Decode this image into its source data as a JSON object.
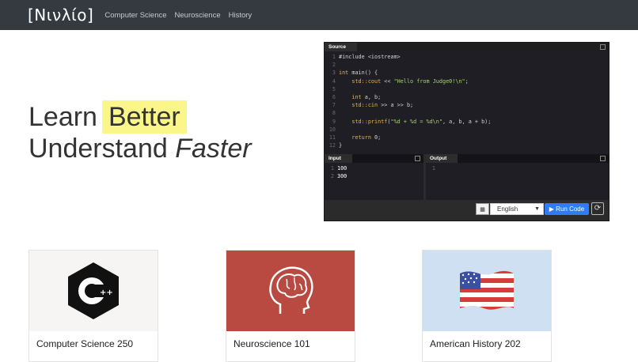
{
  "nav": {
    "brand": "[Νινλίο]",
    "links": [
      "Computer Science",
      "Neuroscience",
      "History"
    ]
  },
  "hero": {
    "line1_prefix": "Learn",
    "line1_highlight": "Better",
    "line2_prefix": "Understand",
    "line2_emphasis": "Faster"
  },
  "ide": {
    "source_tab": "Source",
    "code_lines": [
      "#include <iostream>",
      "",
      "int main() {",
      "    std::cout << \"Hello from Judge0!\\n\";",
      "",
      "    int a, b;",
      "    std::cin >> a >> b;",
      "",
      "    std::printf(\"%d + %d = %d\\n\", a, b, a + b);",
      "",
      "    return 0;",
      "}"
    ],
    "input_tab": "Input",
    "input_lines": [
      "100",
      "300"
    ],
    "output_tab": "Output",
    "output_lines": [
      ""
    ],
    "language": "English",
    "run_label": "Run Code"
  },
  "courses": [
    {
      "title": "Computer Science 250",
      "bg": "#f6f5f3"
    },
    {
      "title": "Neuroscience 101",
      "bg": "#b84a42"
    },
    {
      "title": "American History 202",
      "bg": "#cfe0f3"
    }
  ],
  "colors": {
    "navbar": "#343a40",
    "highlight": "#fbf68a",
    "run_button": "#2f7cf6"
  }
}
